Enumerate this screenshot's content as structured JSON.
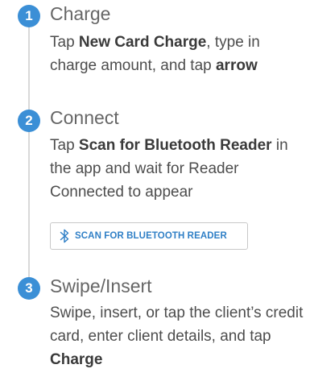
{
  "accent_color": "#3b8fd6",
  "steps": [
    {
      "number": "1",
      "title": "Charge",
      "desc_parts": [
        "Tap ",
        "New Card Charge",
        ", type in charge amount, and tap ",
        "arrow"
      ]
    },
    {
      "number": "2",
      "title": "Connect",
      "desc_parts": [
        "Tap ",
        "Scan for Bluetooth Reader",
        " in the app and wait for Reader Connected to appear"
      ],
      "button": {
        "icon": "bluetooth-icon",
        "label": "SCAN FOR BLUETOOTH READER"
      }
    },
    {
      "number": "3",
      "title": "Swipe/Insert",
      "desc_parts": [
        "Swipe, insert, or tap the client’s credit card, enter client details, and tap ",
        "Charge"
      ]
    }
  ]
}
